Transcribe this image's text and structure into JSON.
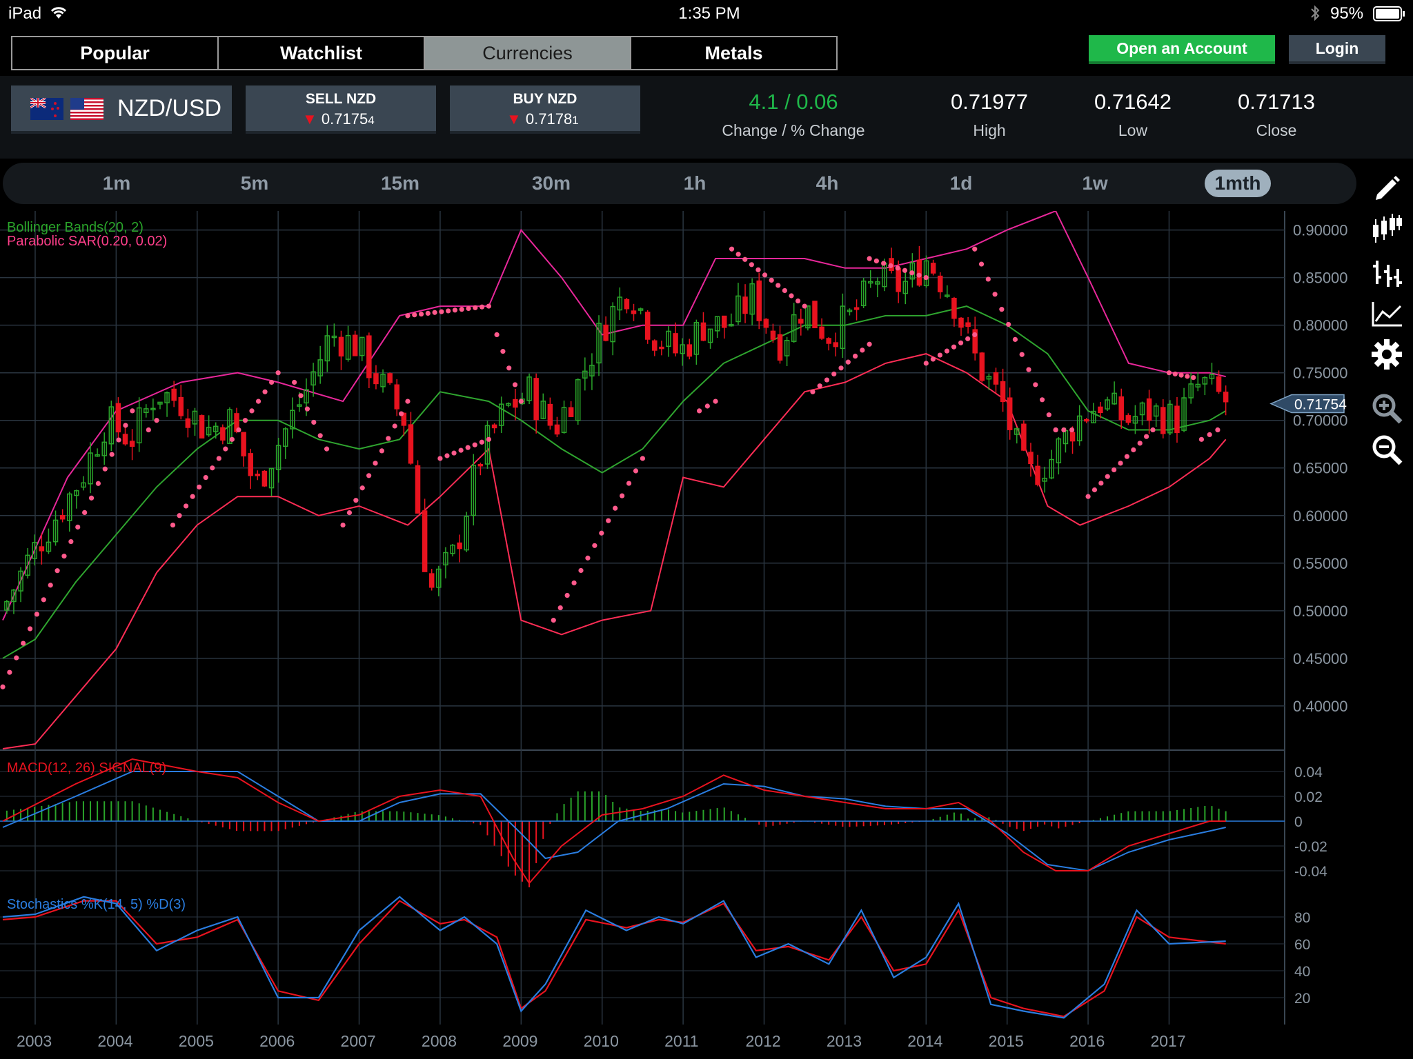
{
  "status_bar": {
    "device": "iPad",
    "time": "1:35 PM",
    "battery": "95%"
  },
  "tabs": [
    {
      "label": "Popular",
      "active": false
    },
    {
      "label": "Watchlist",
      "active": false
    },
    {
      "label": "Currencies",
      "active": true
    },
    {
      "label": "Metals",
      "active": false
    }
  ],
  "actions": {
    "open_account": "Open an Account",
    "login": "Login"
  },
  "instrument": {
    "pair": "NZD/USD",
    "sell_label": "SELL NZD",
    "sell_price": "0.7175",
    "sell_pip": "4",
    "buy_label": "BUY NZD",
    "buy_price": "0.7178",
    "buy_pip": "1"
  },
  "stats": {
    "change_value": "4.1 / 0.06",
    "change_label": "Change / % Change",
    "high_value": "0.71977",
    "high_label": "High",
    "low_value": "0.71642",
    "low_label": "Low",
    "close_value": "0.71713",
    "close_label": "Close"
  },
  "timeframes": [
    {
      "label": "1m",
      "active": false
    },
    {
      "label": "5m",
      "active": false
    },
    {
      "label": "15m",
      "active": false
    },
    {
      "label": "30m",
      "active": false
    },
    {
      "label": "1h",
      "active": false
    },
    {
      "label": "4h",
      "active": false
    },
    {
      "label": "1d",
      "active": false
    },
    {
      "label": "1w",
      "active": false
    },
    {
      "label": "1mth",
      "active": true
    }
  ],
  "tools": [
    "pencil-icon",
    "candlestick-icon",
    "bar-ohlc-icon",
    "line-chart-icon",
    "gear-icon",
    "zoom-in-icon",
    "zoom-out-icon"
  ],
  "colors": {
    "up": "#2aa52a",
    "down": "#e8131f",
    "upper_band": "#e8279a",
    "lower_band": "#ff2d55",
    "mid_band": "#2fa52f",
    "sar": "#ff5a8c",
    "macd": "#e8131f",
    "signal": "#2a7de0",
    "accent_green": "#1fb84a"
  },
  "chart_data": {
    "type": "candlestick",
    "legend": {
      "bollinger": "Bollinger Bands(20, 2)",
      "sar": "Parabolic SAR(0.20, 0.02)"
    },
    "price_label": "0.71754",
    "price_value": 0.71754,
    "x_labels": [
      "2003",
      "2004",
      "2005",
      "2006",
      "2007",
      "2008",
      "2009",
      "2010",
      "2011",
      "2012",
      "2013",
      "2014",
      "2015",
      "2016",
      "2017"
    ],
    "y_ticks": [
      "0.90000",
      "0.85000",
      "0.80000",
      "0.75000",
      "0.70000",
      "0.65000",
      "0.60000",
      "0.55000",
      "0.50000",
      "0.45000",
      "0.40000"
    ],
    "y_range": [
      0.355,
      0.92
    ],
    "close_series": [
      0.51,
      0.56,
      0.6,
      0.64,
      0.7,
      0.68,
      0.73,
      0.72,
      0.69,
      0.7,
      0.63,
      0.68,
      0.73,
      0.79,
      0.78,
      0.74,
      0.7,
      0.52,
      0.56,
      0.66,
      0.71,
      0.73,
      0.69,
      0.74,
      0.8,
      0.84,
      0.79,
      0.77,
      0.8,
      0.8,
      0.83,
      0.78,
      0.82,
      0.79,
      0.81,
      0.85,
      0.84,
      0.87,
      0.83,
      0.76,
      0.72,
      0.64,
      0.66,
      0.7,
      0.72,
      0.7,
      0.71,
      0.7,
      0.74,
      0.72
    ],
    "upper_band": [
      [
        2002.6,
        0.49
      ],
      [
        2003.4,
        0.64
      ],
      [
        2004.0,
        0.71
      ],
      [
        2004.8,
        0.74
      ],
      [
        2005.5,
        0.75
      ],
      [
        2006.0,
        0.74
      ],
      [
        2006.8,
        0.72
      ],
      [
        2007.5,
        0.81
      ],
      [
        2008.0,
        0.82
      ],
      [
        2008.6,
        0.82
      ],
      [
        2009.0,
        0.9
      ],
      [
        2009.5,
        0.85
      ],
      [
        2010.0,
        0.79
      ],
      [
        2010.5,
        0.8
      ],
      [
        2011.0,
        0.8
      ],
      [
        2011.4,
        0.87
      ],
      [
        2012.0,
        0.87
      ],
      [
        2012.5,
        0.87
      ],
      [
        2013.0,
        0.86
      ],
      [
        2013.5,
        0.86
      ],
      [
        2014.0,
        0.87
      ],
      [
        2014.5,
        0.88
      ],
      [
        2015.0,
        0.9
      ],
      [
        2015.6,
        0.92
      ],
      [
        2016.0,
        0.85
      ],
      [
        2016.5,
        0.76
      ],
      [
        2017.0,
        0.75
      ],
      [
        2017.5,
        0.75
      ],
      [
        2017.7,
        0.746
      ]
    ],
    "lower_band": [
      [
        2002.6,
        0.355
      ],
      [
        2003.0,
        0.36
      ],
      [
        2003.6,
        0.42
      ],
      [
        2004.0,
        0.46
      ],
      [
        2004.5,
        0.54
      ],
      [
        2005.0,
        0.59
      ],
      [
        2005.5,
        0.62
      ],
      [
        2006.0,
        0.62
      ],
      [
        2006.5,
        0.6
      ],
      [
        2007.0,
        0.61
      ],
      [
        2007.6,
        0.59
      ],
      [
        2008.0,
        0.62
      ],
      [
        2008.6,
        0.67
      ],
      [
        2009.0,
        0.49
      ],
      [
        2009.5,
        0.475
      ],
      [
        2010.0,
        0.49
      ],
      [
        2010.6,
        0.5
      ],
      [
        2011.0,
        0.64
      ],
      [
        2011.5,
        0.63
      ],
      [
        2012.0,
        0.68
      ],
      [
        2012.5,
        0.73
      ],
      [
        2013.0,
        0.74
      ],
      [
        2013.5,
        0.76
      ],
      [
        2014.0,
        0.77
      ],
      [
        2014.5,
        0.75
      ],
      [
        2015.0,
        0.72
      ],
      [
        2015.5,
        0.61
      ],
      [
        2015.9,
        0.59
      ],
      [
        2016.5,
        0.61
      ],
      [
        2017.0,
        0.63
      ],
      [
        2017.5,
        0.66
      ],
      [
        2017.7,
        0.68
      ]
    ],
    "mid_band": [
      [
        2002.6,
        0.45
      ],
      [
        2003.0,
        0.47
      ],
      [
        2003.5,
        0.53
      ],
      [
        2004.0,
        0.58
      ],
      [
        2004.5,
        0.63
      ],
      [
        2005.0,
        0.67
      ],
      [
        2005.5,
        0.7
      ],
      [
        2006.0,
        0.7
      ],
      [
        2006.5,
        0.68
      ],
      [
        2007.0,
        0.67
      ],
      [
        2007.5,
        0.68
      ],
      [
        2008.0,
        0.73
      ],
      [
        2008.6,
        0.72
      ],
      [
        2009.0,
        0.7
      ],
      [
        2009.5,
        0.67
      ],
      [
        2010.0,
        0.645
      ],
      [
        2010.5,
        0.67
      ],
      [
        2011.0,
        0.72
      ],
      [
        2011.5,
        0.76
      ],
      [
        2012.0,
        0.78
      ],
      [
        2012.5,
        0.8
      ],
      [
        2013.0,
        0.8
      ],
      [
        2013.5,
        0.81
      ],
      [
        2014.0,
        0.81
      ],
      [
        2014.5,
        0.82
      ],
      [
        2015.0,
        0.8
      ],
      [
        2015.5,
        0.77
      ],
      [
        2016.0,
        0.71
      ],
      [
        2016.5,
        0.69
      ],
      [
        2017.0,
        0.69
      ],
      [
        2017.5,
        0.7
      ],
      [
        2017.7,
        0.71
      ]
    ],
    "sar_segments": [
      {
        "start": [
          2002.6,
          0.42
        ],
        "end": [
          2004.2,
          0.71
        ]
      },
      {
        "start": [
          2004.5,
          0.7
        ],
        "end": [
          2004.4,
          0.69
        ]
      },
      {
        "start": [
          2004.7,
          0.59
        ],
        "end": [
          2006.0,
          0.75
        ]
      },
      {
        "start": [
          2006.2,
          0.74
        ],
        "end": [
          2006.6,
          0.67
        ]
      },
      {
        "start": [
          2006.8,
          0.59
        ],
        "end": [
          2007.6,
          0.72
        ]
      },
      {
        "start": [
          2007.6,
          0.81
        ],
        "end": [
          2008.6,
          0.82
        ]
      },
      {
        "start": [
          2008.7,
          0.79
        ],
        "end": [
          2009.0,
          0.72
        ]
      },
      {
        "start": [
          2008.0,
          0.66
        ],
        "end": [
          2008.6,
          0.68
        ]
      },
      {
        "start": [
          2009.4,
          0.49
        ],
        "end": [
          2010.5,
          0.66
        ]
      },
      {
        "start": [
          2011.2,
          0.71
        ],
        "end": [
          2011.4,
          0.72
        ]
      },
      {
        "start": [
          2011.6,
          0.88
        ],
        "end": [
          2012.5,
          0.82
        ]
      },
      {
        "start": [
          2012.6,
          0.73
        ],
        "end": [
          2013.3,
          0.78
        ]
      },
      {
        "start": [
          2013.3,
          0.87
        ],
        "end": [
          2014.0,
          0.85
        ]
      },
      {
        "start": [
          2014.0,
          0.76
        ],
        "end": [
          2014.6,
          0.79
        ]
      },
      {
        "start": [
          2014.6,
          0.88
        ],
        "end": [
          2015.6,
          0.69
        ]
      },
      {
        "start": [
          2015.6,
          0.69
        ],
        "end": [
          2015.8,
          0.69
        ]
      },
      {
        "start": [
          2016.0,
          0.62
        ],
        "end": [
          2016.8,
          0.69
        ]
      },
      {
        "start": [
          2017.0,
          0.75
        ],
        "end": [
          2017.3,
          0.745
        ]
      },
      {
        "start": [
          2017.4,
          0.68
        ],
        "end": [
          2017.6,
          0.69
        ]
      }
    ],
    "macd": {
      "label": "MACD(12, 26) SIGNAL(9)",
      "y_ticks": [
        "0.04",
        "0.02",
        "0",
        "-0.02",
        "-0.04"
      ],
      "y_range": [
        -0.05,
        0.05
      ],
      "macd_line": [
        [
          2002.6,
          0.0
        ],
        [
          2003.5,
          0.03
        ],
        [
          2004.2,
          0.05
        ],
        [
          2005.0,
          0.04
        ],
        [
          2005.5,
          0.035
        ],
        [
          2006.0,
          0.015
        ],
        [
          2006.5,
          0.0
        ],
        [
          2007.0,
          0.005
        ],
        [
          2007.5,
          0.02
        ],
        [
          2008.0,
          0.025
        ],
        [
          2008.5,
          0.02
        ],
        [
          2008.9,
          -0.03
        ],
        [
          2009.1,
          -0.05
        ],
        [
          2009.5,
          -0.02
        ],
        [
          2010.0,
          0.005
        ],
        [
          2010.5,
          0.01
        ],
        [
          2011.0,
          0.02
        ],
        [
          2011.5,
          0.037
        ],
        [
          2012.0,
          0.025
        ],
        [
          2012.5,
          0.02
        ],
        [
          2013.0,
          0.015
        ],
        [
          2013.5,
          0.01
        ],
        [
          2014.0,
          0.01
        ],
        [
          2014.4,
          0.015
        ],
        [
          2014.8,
          0.0
        ],
        [
          2015.2,
          -0.025
        ],
        [
          2015.6,
          -0.04
        ],
        [
          2016.0,
          -0.04
        ],
        [
          2016.5,
          -0.02
        ],
        [
          2017.0,
          -0.01
        ],
        [
          2017.5,
          0.0
        ],
        [
          2017.7,
          0.0
        ]
      ],
      "signal_line": [
        [
          2002.6,
          -0.005
        ],
        [
          2003.5,
          0.02
        ],
        [
          2004.2,
          0.04
        ],
        [
          2005.0,
          0.04
        ],
        [
          2005.5,
          0.04
        ],
        [
          2006.0,
          0.02
        ],
        [
          2006.5,
          0.0
        ],
        [
          2007.0,
          0.0
        ],
        [
          2007.5,
          0.015
        ],
        [
          2008.0,
          0.022
        ],
        [
          2008.5,
          0.022
        ],
        [
          2009.0,
          -0.01
        ],
        [
          2009.3,
          -0.03
        ],
        [
          2009.7,
          -0.025
        ],
        [
          2010.2,
          0.0
        ],
        [
          2010.8,
          0.01
        ],
        [
          2011.5,
          0.03
        ],
        [
          2012.0,
          0.028
        ],
        [
          2012.5,
          0.02
        ],
        [
          2013.0,
          0.018
        ],
        [
          2013.5,
          0.012
        ],
        [
          2014.0,
          0.01
        ],
        [
          2014.5,
          0.01
        ],
        [
          2015.0,
          -0.01
        ],
        [
          2015.5,
          -0.035
        ],
        [
          2016.0,
          -0.04
        ],
        [
          2016.5,
          -0.025
        ],
        [
          2017.0,
          -0.015
        ],
        [
          2017.5,
          -0.008
        ],
        [
          2017.7,
          -0.005
        ]
      ]
    },
    "stochastics": {
      "label": "Stochastics %K(14, 5) %D(3)",
      "y_ticks": [
        "80",
        "60",
        "40",
        "20"
      ],
      "y_range": [
        0,
        100
      ],
      "k_line": [
        [
          2002.6,
          80
        ],
        [
          2003.0,
          82
        ],
        [
          2003.6,
          95
        ],
        [
          2004.0,
          90
        ],
        [
          2004.5,
          55
        ],
        [
          2005.0,
          70
        ],
        [
          2005.5,
          80
        ],
        [
          2006.0,
          20
        ],
        [
          2006.5,
          20
        ],
        [
          2007.0,
          70
        ],
        [
          2007.5,
          95
        ],
        [
          2008.0,
          70
        ],
        [
          2008.3,
          80
        ],
        [
          2008.7,
          60
        ],
        [
          2009.0,
          10
        ],
        [
          2009.3,
          30
        ],
        [
          2009.8,
          85
        ],
        [
          2010.3,
          70
        ],
        [
          2010.7,
          80
        ],
        [
          2011.0,
          75
        ],
        [
          2011.5,
          92
        ],
        [
          2011.9,
          50
        ],
        [
          2012.3,
          60
        ],
        [
          2012.8,
          45
        ],
        [
          2013.2,
          85
        ],
        [
          2013.6,
          35
        ],
        [
          2014.0,
          50
        ],
        [
          2014.4,
          90
        ],
        [
          2014.8,
          15
        ],
        [
          2015.2,
          10
        ],
        [
          2015.7,
          5
        ],
        [
          2016.2,
          30
        ],
        [
          2016.6,
          85
        ],
        [
          2017.0,
          60
        ],
        [
          2017.7,
          62
        ]
      ],
      "d_line": [
        [
          2002.6,
          78
        ],
        [
          2003.0,
          80
        ],
        [
          2003.6,
          92
        ],
        [
          2004.0,
          92
        ],
        [
          2004.5,
          60
        ],
        [
          2005.0,
          65
        ],
        [
          2005.5,
          78
        ],
        [
          2006.0,
          25
        ],
        [
          2006.5,
          18
        ],
        [
          2007.0,
          60
        ],
        [
          2007.5,
          92
        ],
        [
          2008.0,
          75
        ],
        [
          2008.3,
          78
        ],
        [
          2008.7,
          65
        ],
        [
          2009.0,
          12
        ],
        [
          2009.3,
          25
        ],
        [
          2009.8,
          78
        ],
        [
          2010.3,
          72
        ],
        [
          2010.7,
          78
        ],
        [
          2011.0,
          76
        ],
        [
          2011.5,
          90
        ],
        [
          2011.9,
          55
        ],
        [
          2012.3,
          58
        ],
        [
          2012.8,
          48
        ],
        [
          2013.2,
          80
        ],
        [
          2013.6,
          40
        ],
        [
          2014.0,
          45
        ],
        [
          2014.4,
          85
        ],
        [
          2014.8,
          20
        ],
        [
          2015.2,
          12
        ],
        [
          2015.7,
          6
        ],
        [
          2016.2,
          25
        ],
        [
          2016.6,
          80
        ],
        [
          2017.0,
          65
        ],
        [
          2017.7,
          60
        ]
      ]
    }
  }
}
